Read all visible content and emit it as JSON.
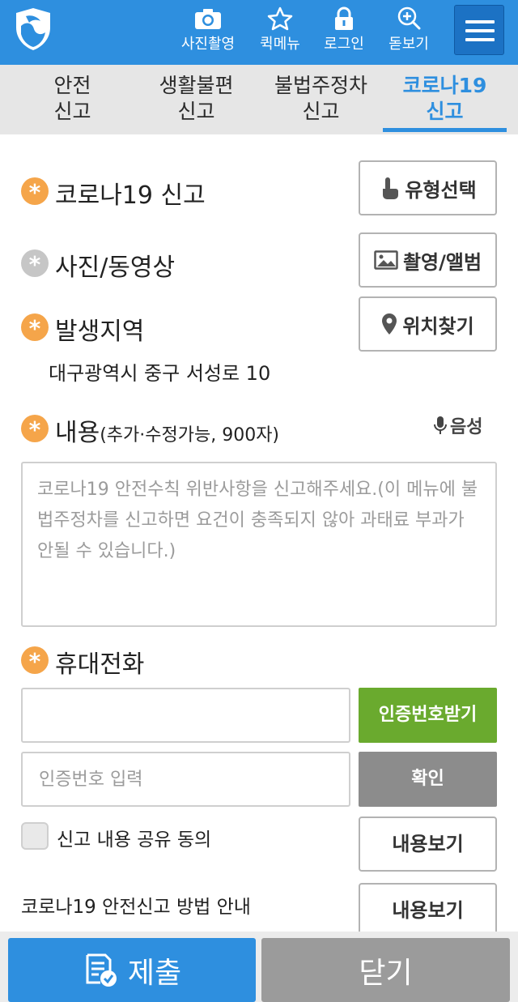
{
  "header": {
    "camera_label": "사진촬영",
    "quickmenu_label": "퀵메뉴",
    "login_label": "로그인",
    "zoom_label": "돋보기"
  },
  "tabs": [
    {
      "line1": "안전",
      "line2": "신고"
    },
    {
      "line1": "생활불편",
      "line2": "신고"
    },
    {
      "line1": "불법주정차",
      "line2": "신고"
    },
    {
      "line1": "코로나19",
      "line2": "신고"
    }
  ],
  "form": {
    "report_title": "코로나19 신고",
    "type_select_label": "유형선택",
    "media_title": "사진/동영상",
    "media_button_label": "촬영/앨범",
    "location_title": "발생지역",
    "location_button_label": "위치찾기",
    "address": "대구광역시 중구 서성로 10",
    "content_title": "내용",
    "content_hint": "(추가·수정가능, 900자)",
    "voice_label": "음성",
    "content_placeholder": "코로나19 안전수칙 위반사항을 신고해주세요.(이 메뉴에 불법주정차를 신고하면 요건이 충족되지 않아 과태료 부과가 안될 수 있습니다.)",
    "phone_title": "휴대전화",
    "phone_value": "",
    "request_code_label": "인증번호받기",
    "code_placeholder": "인증번호 입력",
    "confirm_label": "확인",
    "agree_label": "신고 내용 공유 동의",
    "view_label_1": "내용보기",
    "guide_label": "코로나19 안전신고 방법 안내",
    "view_label_2": "내용보기"
  },
  "footer": {
    "submit_label": "제출",
    "close_label": "닫기"
  },
  "colors": {
    "primary": "#2e8fdf",
    "required_star": "#f5a54a",
    "green_button": "#6aaa2e",
    "gray_button": "#8c8c8c"
  }
}
